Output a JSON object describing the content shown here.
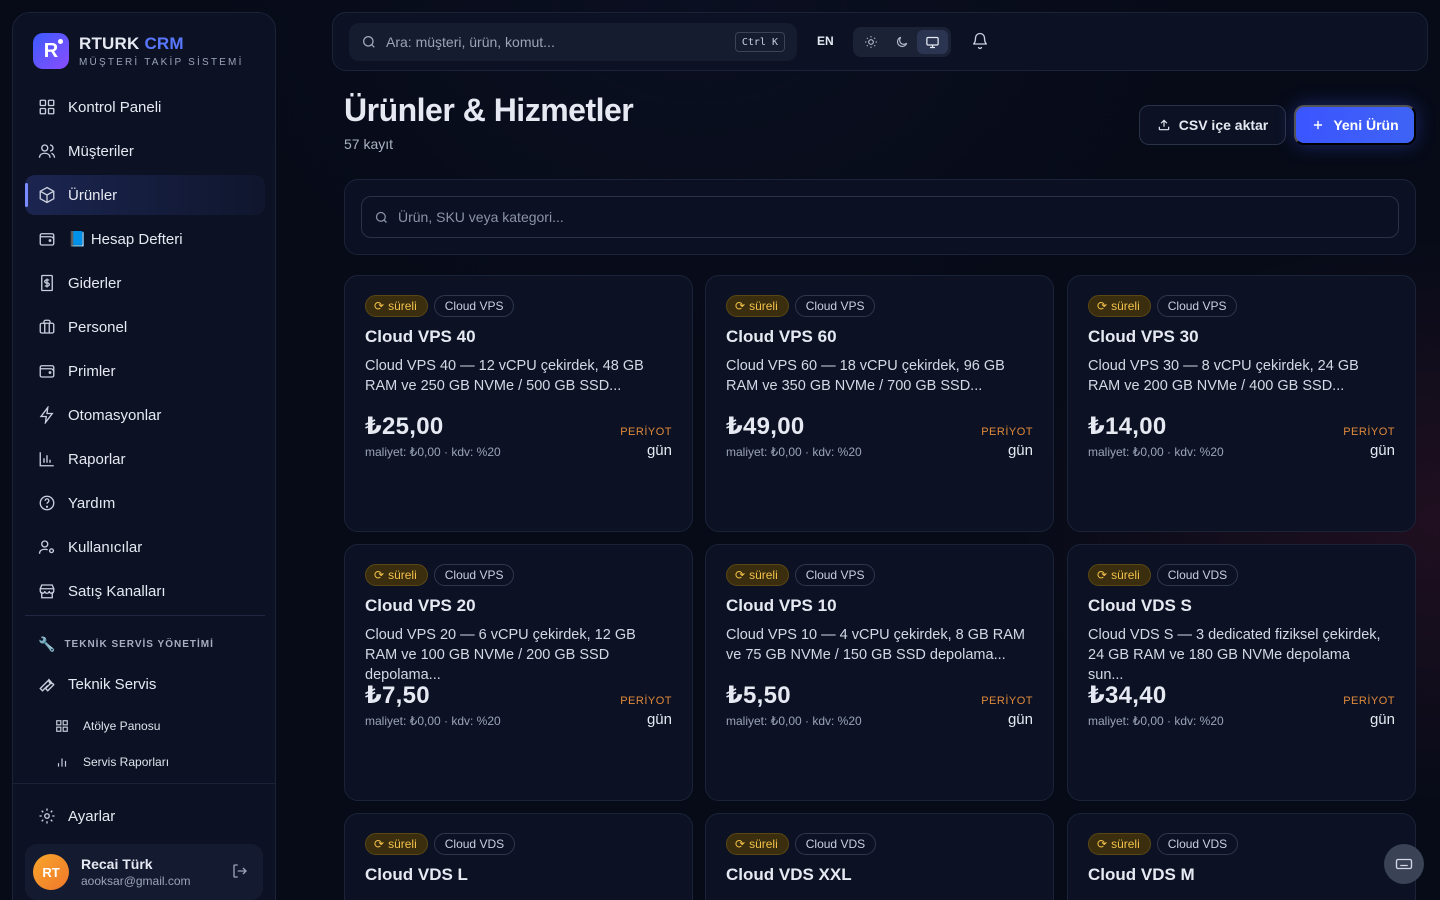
{
  "brand": {
    "name": "RTURK",
    "accent": "CRM",
    "subtitle": "MÜŞTERİ TAKİP SİSTEMİ",
    "logo_letter": "R"
  },
  "nav": [
    {
      "label": "Kontrol Paneli",
      "icon": "dashboard-icon",
      "active": false
    },
    {
      "label": "Müşteriler",
      "icon": "users-icon",
      "active": false
    },
    {
      "label": "Ürünler",
      "icon": "package-icon",
      "active": true
    },
    {
      "label": "📘 Hesap Defteri",
      "icon": "wallet-icon",
      "active": false
    },
    {
      "label": "Giderler",
      "icon": "receipt-icon",
      "active": false
    },
    {
      "label": "Personel",
      "icon": "briefcase-icon",
      "active": false
    },
    {
      "label": "Primler",
      "icon": "wallet-icon",
      "active": false
    },
    {
      "label": "Otomasyonlar",
      "icon": "bolt-icon",
      "active": false
    },
    {
      "label": "Raporlar",
      "icon": "chart-icon",
      "active": false
    },
    {
      "label": "Yardım",
      "icon": "help-icon",
      "active": false
    },
    {
      "label": "Kullanıcılar",
      "icon": "user-gear-icon",
      "active": false
    },
    {
      "label": "Satış Kanalları",
      "icon": "store-icon",
      "active": false
    }
  ],
  "tech_section": {
    "title": "TEKNİK SERVİS YÖNETİMİ",
    "main": "Teknik Servis",
    "sub": [
      "Atölye Panosu",
      "Servis Raporları"
    ]
  },
  "settings_label": "Ayarlar",
  "user": {
    "initials": "RT",
    "name": "Recai Türk",
    "email": "aooksar@gmail.com"
  },
  "topbar": {
    "search_placeholder": "Ara: müşteri, ürün, komut...",
    "shortcut": "Ctrl K",
    "lang": "EN"
  },
  "page": {
    "title": "Ürünler & Hizmetler",
    "count": "57 kayıt",
    "csv_button": "CSV içe aktar",
    "new_button": "Yeni Ürün",
    "filter_placeholder": "Ürün, SKU veya kategori..."
  },
  "cards": [
    {
      "period_tag": "süreli",
      "category": "Cloud VPS",
      "title": "Cloud VPS 40",
      "desc": "Cloud VPS 40 — 12 vCPU çekirdek, 48 GB RAM ve 250 GB NVMe / 500 GB SSD...",
      "price": "₺25,00",
      "meta": "maliyet: ₺0,00 · kdv: %20",
      "period_label": "PERİYOT",
      "period": "gün"
    },
    {
      "period_tag": "süreli",
      "category": "Cloud VPS",
      "title": "Cloud VPS 60",
      "desc": "Cloud VPS 60 — 18 vCPU çekirdek, 96 GB RAM ve 350 GB NVMe / 700 GB SSD...",
      "price": "₺49,00",
      "meta": "maliyet: ₺0,00 · kdv: %20",
      "period_label": "PERİYOT",
      "period": "gün"
    },
    {
      "period_tag": "süreli",
      "category": "Cloud VPS",
      "title": "Cloud VPS 30",
      "desc": "Cloud VPS 30 — 8 vCPU çekirdek, 24 GB RAM ve 200 GB NVMe / 400 GB SSD...",
      "price": "₺14,00",
      "meta": "maliyet: ₺0,00 · kdv: %20",
      "period_label": "PERİYOT",
      "period": "gün"
    },
    {
      "period_tag": "süreli",
      "category": "Cloud VPS",
      "title": "Cloud VPS 20",
      "desc": "Cloud VPS 20 — 6 vCPU çekirdek, 12 GB RAM ve 100 GB NVMe / 200 GB SSD depolama...",
      "price": "₺7,50",
      "meta": "maliyet: ₺0,00 · kdv: %20",
      "period_label": "PERİYOT",
      "period": "gün"
    },
    {
      "period_tag": "süreli",
      "category": "Cloud VPS",
      "title": "Cloud VPS 10",
      "desc": "Cloud VPS 10 — 4 vCPU çekirdek, 8 GB RAM ve 75 GB NVMe / 150 GB SSD depolama...",
      "price": "₺5,50",
      "meta": "maliyet: ₺0,00 · kdv: %20",
      "period_label": "PERİYOT",
      "period": "gün"
    },
    {
      "period_tag": "süreli",
      "category": "Cloud VDS",
      "title": "Cloud VDS S",
      "desc": "Cloud VDS S — 3 dedicated fiziksel çekirdek, 24 GB RAM ve 180 GB NVMe depolama sun...",
      "price": "₺34,40",
      "meta": "maliyet: ₺0,00 · kdv: %20",
      "period_label": "PERİYOT",
      "period": "gün"
    },
    {
      "period_tag": "süreli",
      "category": "Cloud VDS",
      "title": "Cloud VDS L",
      "desc": "",
      "price": "",
      "meta": "",
      "period_label": "",
      "period": ""
    },
    {
      "period_tag": "süreli",
      "category": "Cloud VDS",
      "title": "Cloud VDS XXL",
      "desc": "",
      "price": "",
      "meta": "",
      "period_label": "",
      "period": ""
    },
    {
      "period_tag": "süreli",
      "category": "Cloud VDS",
      "title": "Cloud VDS M",
      "desc": "",
      "price": "",
      "meta": "",
      "period_label": "",
      "period": ""
    }
  ],
  "icons": {
    "fab": "keyboard-icon"
  }
}
